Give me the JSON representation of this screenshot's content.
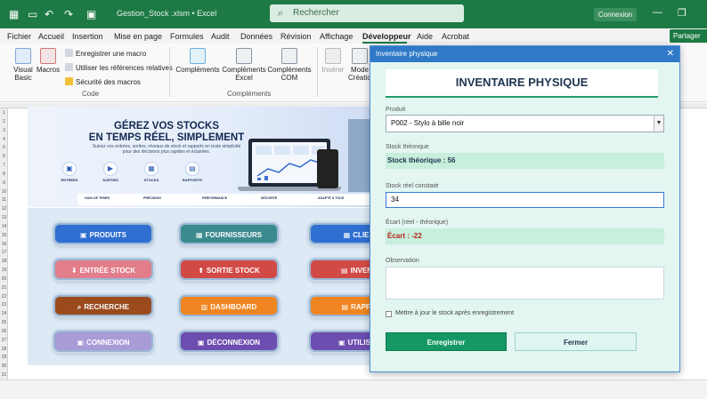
{
  "titlebar": {
    "file_name": "Gestion_Stock .xlsm  •  Excel",
    "search_placeholder": "Rechercher",
    "connect_label": "Connexion",
    "icons": [
      "excel-icon",
      "save-icon",
      "undo-icon",
      "redo-icon",
      "autosave-icon"
    ],
    "minimize": "—",
    "restore": "❐",
    "close": "✕"
  },
  "menu": {
    "items": [
      "Fichier",
      "Accueil",
      "Insertion",
      "Mise en page",
      "Formules",
      "Audit",
      "Données",
      "Révision",
      "Affichage",
      "Développeur",
      "Aide",
      "Acrobat"
    ],
    "active": "Développeur",
    "share_label": "Partager"
  },
  "ribbon": {
    "code": {
      "visual_basic": "Visual Basic",
      "macros": "Macros",
      "record_macro": "Enregistrer une macro",
      "relative_refs": "Utiliser les références relatives",
      "macro_security": "Sécurité des macros",
      "group_label": "Code"
    },
    "addins": {
      "complements": "Compléments",
      "excel_addins": "Compléments Excel",
      "com_addins": "Compléments COM",
      "group_label": "Compléments"
    },
    "controls": {
      "insert": "Insérer",
      "design_mode": "Mode Création"
    }
  },
  "banner": {
    "headline_line1": "GÉREZ VOS STOCKS",
    "headline_line2": "EN TEMPS RÉEL, SIMPLEMENT",
    "subtitle": "Suivez vos entrées, sorties, niveaux de stock et rapports en toute simplicité pour des décisions plus rapides et éclairées.",
    "features": [
      "ENTRÉES",
      "SORTIES",
      "STOCKS",
      "RAPPORTS"
    ],
    "benefits": [
      "GAIN DE TEMPS",
      "PRÉCISION",
      "PERFORMANCE",
      "SÉCURITÉ",
      "ADAPTÉ À TOUS"
    ]
  },
  "nav": {
    "produits": "PRODUITS",
    "fournisseurs": "FOURNISSEURS",
    "clients": "CLIEN",
    "entree": "ENTRÉE STOCK",
    "sortie": "SORTIE STOCK",
    "inventaire": "INVENT",
    "recherche": "RECHERCHE",
    "dashboard": "DASHBOARD",
    "rapports": "RAPPO",
    "connexion": "CONNEXION",
    "deconnexion": "DÉCONNEXION",
    "utilisateurs": "UTILISAT",
    "colors": {
      "blue": "#2e6fd1",
      "teal": "#3a8a8e",
      "pink": "#e27d8a",
      "red": "#d24a45",
      "brown": "#9b4a1c",
      "orange": "#ef8520",
      "lavender": "#a89bd6",
      "purple": "#6c4db0"
    }
  },
  "dialog": {
    "window_title": "Inventaire physique",
    "heading": "INVENTAIRE PHYSIQUE",
    "produit_label": "Produit",
    "produit_value": "P002 - Stylo à bille noir",
    "theorique_label": "Stock théorique",
    "theorique_value": "Stock théorique : 56",
    "reel_label": "Stock réel constaté",
    "reel_value": "34",
    "ecart_label": "Écart (réel - théorique)",
    "ecart_value": "Écart : -22",
    "observation_label": "Observation",
    "observation_value": "",
    "checkbox_label": "Mettre à jour le stock après enregistrement",
    "checkbox_checked": false,
    "save_label": "Enregistrer",
    "close_label": "Fermer"
  },
  "sheet": {
    "row_numbers": [
      "1",
      "2",
      "3",
      "4",
      "5",
      "6",
      "7",
      "8",
      "9",
      "10",
      "11",
      "12",
      "13",
      "14",
      "15",
      "16",
      "17",
      "18",
      "19",
      "20",
      "21",
      "22",
      "23",
      "24",
      "25",
      "26",
      "27",
      "28",
      "29",
      "30",
      "31"
    ]
  }
}
